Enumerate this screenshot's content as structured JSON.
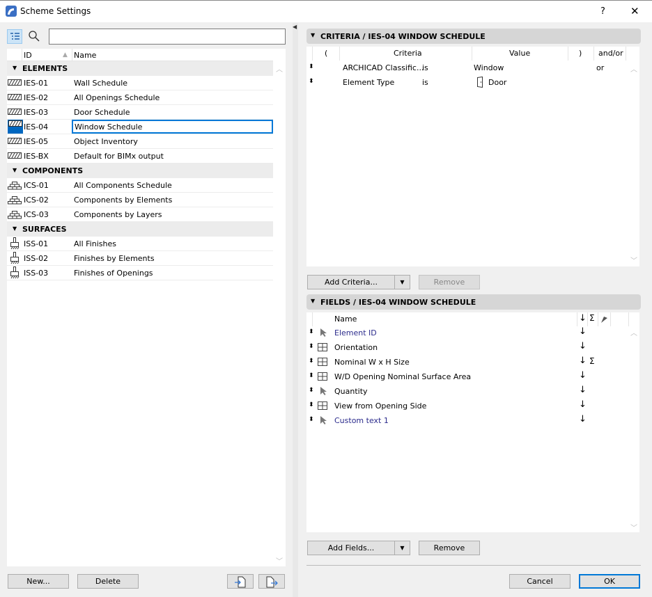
{
  "window": {
    "title": "Scheme Settings",
    "help": "?",
    "close": "✕"
  },
  "left": {
    "search_placeholder": "",
    "columns": {
      "id": "ID",
      "name": "Name"
    },
    "groups": [
      {
        "label": "ELEMENTS",
        "icon": "wall-hatch-icon",
        "items": [
          {
            "id": "IES-01",
            "name": "Wall Schedule"
          },
          {
            "id": "IES-02",
            "name": "All Openings Schedule"
          },
          {
            "id": "IES-03",
            "name": "Door Schedule"
          },
          {
            "id": "IES-04",
            "name": "Window Schedule",
            "selected": true
          },
          {
            "id": "IES-05",
            "name": "Object Inventory"
          },
          {
            "id": "IES-BX",
            "name": "Default for BIMx output"
          }
        ]
      },
      {
        "label": "COMPONENTS",
        "icon": "brick-icon",
        "items": [
          {
            "id": "ICS-01",
            "name": "All Components Schedule"
          },
          {
            "id": "ICS-02",
            "name": "Components by Elements"
          },
          {
            "id": "ICS-03",
            "name": "Components by Layers"
          }
        ]
      },
      {
        "label": "SURFACES",
        "icon": "paintbrush-icon",
        "items": [
          {
            "id": "ISS-01",
            "name": "All Finishes"
          },
          {
            "id": "ISS-02",
            "name": "Finishes by Elements"
          },
          {
            "id": "ISS-03",
            "name": "Finishes of Openings"
          }
        ]
      }
    ],
    "new_label": "New...",
    "delete_label": "Delete"
  },
  "criteria": {
    "header": "CRITERIA / IES-04 WINDOW SCHEDULE",
    "columns": {
      "open": "(",
      "criteria": "Criteria",
      "value": "Value",
      "close": ")",
      "andor": "and/or"
    },
    "rows": [
      {
        "criteria": "ARCHICAD Classific...",
        "op": "is",
        "value": "Window",
        "andor": "or"
      },
      {
        "criteria": "Element Type",
        "op": "is",
        "value": "Door",
        "andor": "",
        "value_icon": "door-icon"
      }
    ],
    "add_label": "Add Criteria...",
    "remove_label": "Remove"
  },
  "fields": {
    "header": "FIELDS / IES-04 WINDOW SCHEDULE",
    "columns": {
      "name": "Name",
      "sort": "↓",
      "sum": "Σ"
    },
    "rows": [
      {
        "icon": "cursor-icon",
        "name": "Element ID",
        "general": true,
        "sort": "↓",
        "sum": ""
      },
      {
        "icon": "window-icon",
        "name": "Orientation",
        "general": false,
        "sort": "↓",
        "sum": ""
      },
      {
        "icon": "window-icon",
        "name": "Nominal W x H Size",
        "general": false,
        "sort": "↓",
        "sum": "Σ"
      },
      {
        "icon": "window-icon",
        "name": "W/D Opening Nominal Surface Area",
        "general": false,
        "sort": "↓",
        "sum": ""
      },
      {
        "icon": "cursor-icon",
        "name": "Quantity",
        "general": false,
        "sort": "↓",
        "sum": ""
      },
      {
        "icon": "window-icon",
        "name": "View from Opening Side",
        "general": false,
        "sort": "↓",
        "sum": ""
      },
      {
        "icon": "cursor-icon",
        "name": "Custom text  1",
        "general": true,
        "sort": "↓",
        "sum": ""
      }
    ],
    "add_label": "Add Fields...",
    "remove_label": "Remove"
  },
  "footer": {
    "cancel_label": "Cancel",
    "ok_label": "OK"
  },
  "colors": {
    "accent": "#0078d7",
    "selection": "#0067c0",
    "link_text": "#2b2b8c"
  }
}
